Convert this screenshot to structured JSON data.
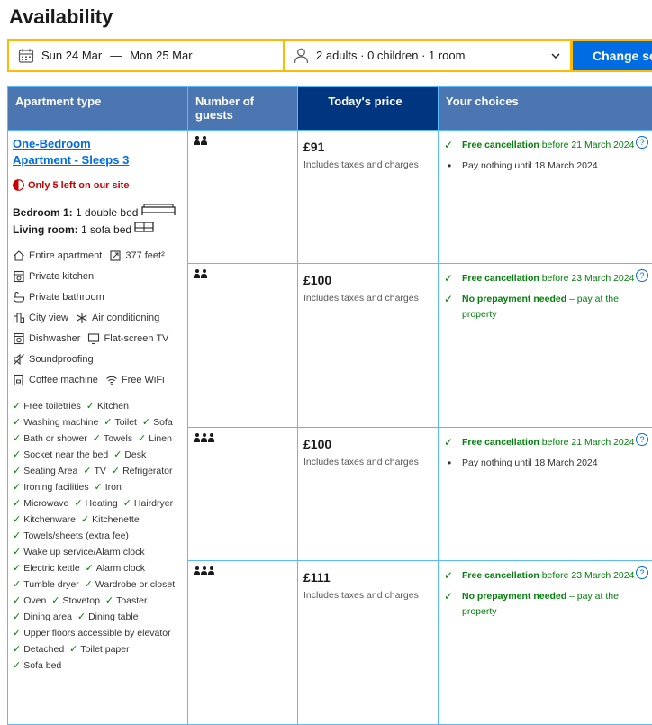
{
  "page": {
    "title": "Availability"
  },
  "search": {
    "check_in": "Sun 24 Mar",
    "dash": "—",
    "check_out": "Mon 25 Mar",
    "occupancy": "2 adults · 0 children · 1 room",
    "button": "Change search"
  },
  "table": {
    "headers": {
      "apartment_type": "Apartment type",
      "guests": "Number of guests",
      "price": "Today's price",
      "choices": "Your choices"
    }
  },
  "apartment": {
    "name": "One-Bedroom Apartment - Sleeps 3",
    "scarcity": "Only 5 left on our site",
    "bed1_label": "Bedroom 1:",
    "bed1_value": "1 double bed",
    "bed2_label": "Living room:",
    "bed2_value": "1 sofa bed",
    "facilities": [
      {
        "icon": "home-icon",
        "label": "Entire apartment"
      },
      {
        "icon": "size-icon",
        "label": "377 feet²"
      },
      {
        "icon": "kitchen-icon",
        "label": "Private kitchen"
      },
      {
        "icon": "bath-icon",
        "label": "Private bathroom"
      },
      {
        "icon": "city-icon",
        "label": "City view"
      },
      {
        "icon": "snowflake-icon",
        "label": "Air conditioning"
      },
      {
        "icon": "dishwasher-icon",
        "label": "Dishwasher"
      },
      {
        "icon": "tv-icon",
        "label": "Flat-screen TV"
      },
      {
        "icon": "soundproof-icon",
        "label": "Soundproofing"
      },
      {
        "icon": "coffee-icon",
        "label": "Coffee machine"
      },
      {
        "icon": "wifi-icon",
        "label": "Free WiFi"
      }
    ],
    "amenities": [
      "Free toiletries",
      "Kitchen",
      "Washing machine",
      "Toilet",
      "Sofa",
      "Bath or shower",
      "Towels",
      "Linen",
      "Socket near the bed",
      "Desk",
      "Seating Area",
      "TV",
      "Refrigerator",
      "Ironing facilities",
      "Iron",
      "Microwave",
      "Heating",
      "Hairdryer",
      "Kitchenware",
      "Kitchenette",
      "Towels/sheets (extra fee)",
      "Wake up service/Alarm clock",
      "Electric kettle",
      "Alarm clock",
      "Tumble dryer",
      "Wardrobe or closet",
      "Oven",
      "Stovetop",
      "Toaster",
      "Dining area",
      "Dining table",
      "Upper floors accessible by elevator",
      "Detached",
      "Toilet paper",
      "Sofa bed"
    ]
  },
  "offers": [
    {
      "guests": 2,
      "price": "£91",
      "price_note": "Includes taxes and charges",
      "choices": [
        {
          "type": "green",
          "bold": "Free cancellation",
          "text": " before 21 March 2024"
        },
        {
          "type": "plain",
          "bold": "",
          "text": "Pay nothing until 18 March 2024"
        }
      ]
    },
    {
      "guests": 2,
      "price": "£100",
      "price_note": "Includes taxes and charges",
      "choices": [
        {
          "type": "green",
          "bold": "Free cancellation",
          "text": " before 23 March 2024"
        },
        {
          "type": "green",
          "bold": "No prepayment needed",
          "text": " – pay at the property"
        }
      ]
    },
    {
      "guests": 3,
      "price": "£100",
      "price_note": "Includes taxes and charges",
      "choices": [
        {
          "type": "green",
          "bold": "Free cancellation",
          "text": " before 21 March 2024"
        },
        {
          "type": "plain",
          "bold": "",
          "text": "Pay nothing until 18 March 2024"
        }
      ]
    },
    {
      "guests": 3,
      "price": "£111",
      "price_note": "Includes taxes and charges",
      "choices": [
        {
          "type": "green",
          "bold": "Free cancellation",
          "text": " before 23 March 2024"
        },
        {
          "type": "green",
          "bold": "No prepayment needed",
          "text": " – pay at the property"
        }
      ]
    }
  ],
  "colors": {
    "accent": "#006ce4",
    "header_bg": "#4c76b2",
    "price_header_bg": "#003580",
    "highlight": "#febb02",
    "green": "#008009",
    "alert": "#cc0000"
  }
}
